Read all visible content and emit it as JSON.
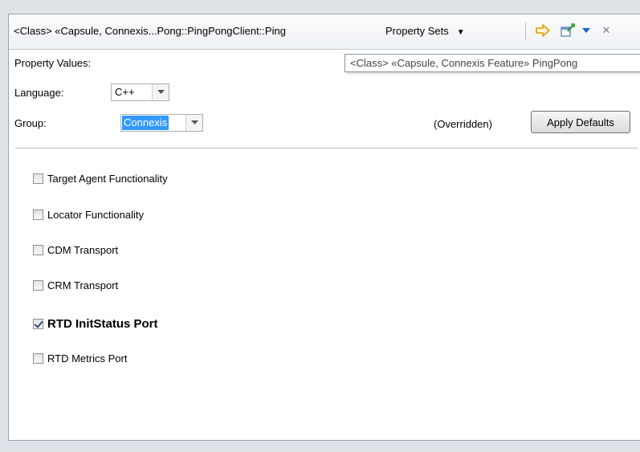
{
  "titlebar": {
    "title": "<Class> «Capsule, Connexis...Pong::PingPongClient::Ping",
    "property_sets_label": "Property Sets",
    "icons": [
      "forward-arrow-icon",
      "pin-edit-icon",
      "view-menu-icon",
      "close-icon"
    ],
    "close_glyph": "✕"
  },
  "tooltip": {
    "text": "<Class> «Capsule, Connexis Feature» PingPong"
  },
  "form": {
    "property_values_label": "Property Values:",
    "language_label": "Language:",
    "language_value": "C++",
    "group_label": "Group:",
    "group_value": "Connexis",
    "overridden_text": "(Overridden)",
    "apply_defaults_label": "Apply Defaults"
  },
  "checkboxes": [
    {
      "label": "Target Agent Functionality",
      "checked": false
    },
    {
      "label": "Locator Functionality",
      "checked": false
    },
    {
      "label": "CDM Transport",
      "checked": false
    },
    {
      "label": "CRM Transport",
      "checked": false
    },
    {
      "label": "RTD InitStatus Port",
      "checked": true
    },
    {
      "label": "RTD Metrics Port",
      "checked": false
    }
  ],
  "colors": {
    "selection": "#3399ff",
    "accent_arrow": "#f0a000",
    "menu_triangle": "#1e63c6"
  }
}
